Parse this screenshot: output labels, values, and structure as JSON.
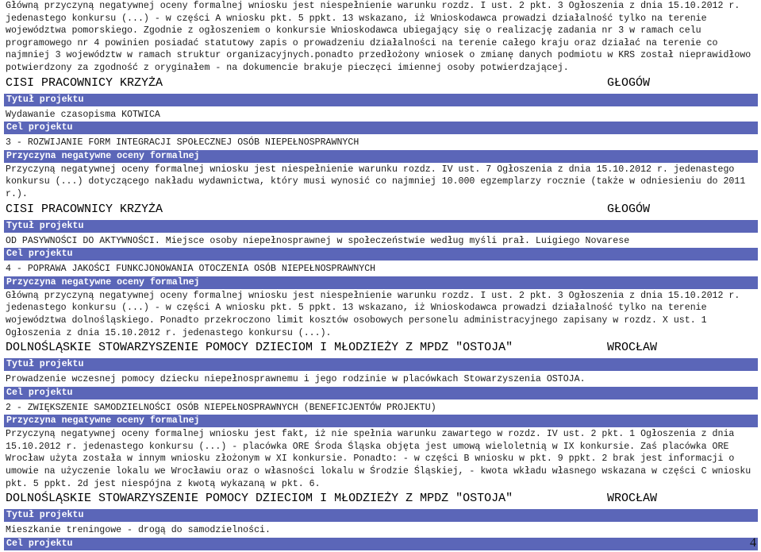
{
  "intro": {
    "text": "Główną przyczyną negatywnej oceny formalnej wniosku jest niespełnienie warunku rozdz. I ust. 2 pkt. 3 Ogłoszenia z dnia 15.10.2012 r. jedenastego konkursu (...) - w części A wniosku pkt. 5 ppkt. 13 wskazano, iż Wnioskodawca prowadzi działalność tylko na terenie województwa pomorskiego. Zgodnie z ogłoszeniem o konkursie Wnioskodawca ubiegający się o realizację zadania nr 3 w ramach celu programowego nr 4 powinien posiadać statutowy zapis o prowadzeniu działalności na terenie całego kraju oraz działać na terenie co najmniej 3 województw w ramach struktur organizacyjnych.ponadto przedłożony wniosek o zmianę danych podmiotu w KRS został nieprawidłowo potwierdzony za zgodność z oryginałem - na dokumencie brakuje pieczęci imiennej osoby potwierdzającej."
  },
  "labels": {
    "title": "Tytuł projektu",
    "goal": "Cel projektu",
    "reason": "Przyczyna negatywne oceny formalnej"
  },
  "entries": [
    {
      "org": "CISI PRACOWNICY KRZYŻA",
      "city": "GŁOGÓW",
      "title": "Wydawanie czasopisma KOTWICA",
      "goal": "3 - ROZWIJANIE FORM INTEGRACJI SPOŁECZNEJ OSÓB NIEPEŁNOSPRAWNYCH",
      "reason": "Przyczyną negatywnej oceny formalnej wniosku jest niespełnienie warunku rozdz. IV ust. 7 Ogłoszenia z dnia 15.10.2012 r. jedenastego konkursu (...) dotyczącego nakładu wydawnictwa, który musi wynosić co najmniej 10.000 egzemplarzy rocznie (także w odniesieniu do 2011 r.)."
    },
    {
      "org": "CISI PRACOWNICY KRZYŻA",
      "city": "GŁOGÓW",
      "title": "OD PASYWNOŚCI DO AKTYWNOŚCI. Miejsce osoby niepełnosprawnej w społeczeństwie według myśli prał. Luigiego Novarese",
      "goal": "4 - POPRAWA JAKOŚCI FUNKCJONOWANIA OTOCZENIA OSÓB NIEPEŁNOSPRAWNYCH",
      "reason": "Główną przyczyną negatywnej oceny formalnej wniosku jest niespełnienie warunku rozdz. I ust. 2 pkt. 3 Ogłoszenia z dnia 15.10.2012 r. jedenastego konkursu (...) - w części A wniosku pkt. 5 ppkt. 13 wskazano, iż Wnioskodawca prowadzi działalność tylko na terenie województwa dolnośląskiego. Ponadto przekroczono limit kosztów osobowych personelu administracyjnego zapisany w rozdz. X ust. 1 Ogłoszenia z dnia 15.10.2012 r. jedenastego konkursu (...)."
    },
    {
      "org": "DOLNOŚLĄSKIE STOWARZYSZENIE POMOCY DZIECIOM I MŁODZIEŻY Z MPDZ \"OSTOJA\"",
      "city": "WROCŁAW",
      "title": "Prowadzenie wczesnej pomocy dziecku niepełnosprawnemu i jego rodzinie w placówkach Stowarzyszenia OSTOJA.",
      "goal": "2 - ZWIĘKSZENIE SAMODZIELNOŚCI OSÓB NIEPEŁNOSPRAWNYCH (BENEFICJENTÓW PROJEKTU)",
      "reason": "Przyczyną negatywnej oceny formalnej wniosku jest fakt, iż nie spełnia warunku zawartego w rozdz. IV ust. 2 pkt. 1 Ogłoszenia z dnia 15.10.2012 r. jedenastego konkursu (...) - placówka ORE Środa Śląska objęta jest umową wieloletnią w IX konkursie. Zaś placówka ORE Wrocław użyta została w innym wniosku złożonym w XI konkursie. Ponadto: - w części B wniosku w pkt. 9 ppkt. 2 brak jest informacji o umowie na użyczenie lokalu we Wrocławiu oraz o własności lokalu w Środzie Śląskiej, - kwota wkładu własnego wskazana w części C wniosku pkt. 5 ppkt. 2d jest niespójna z kwotą wykazaną w pkt. 6."
    },
    {
      "org": "DOLNOŚLĄSKIE STOWARZYSZENIE POMOCY DZIECIOM I MŁODZIEŻY Z MPDZ \"OSTOJA\"",
      "city": "WROCŁAW",
      "title": "Mieszkanie treningowe - drogą do samodzielności.",
      "goal": "",
      "reason": ""
    }
  ],
  "page_number": "4"
}
